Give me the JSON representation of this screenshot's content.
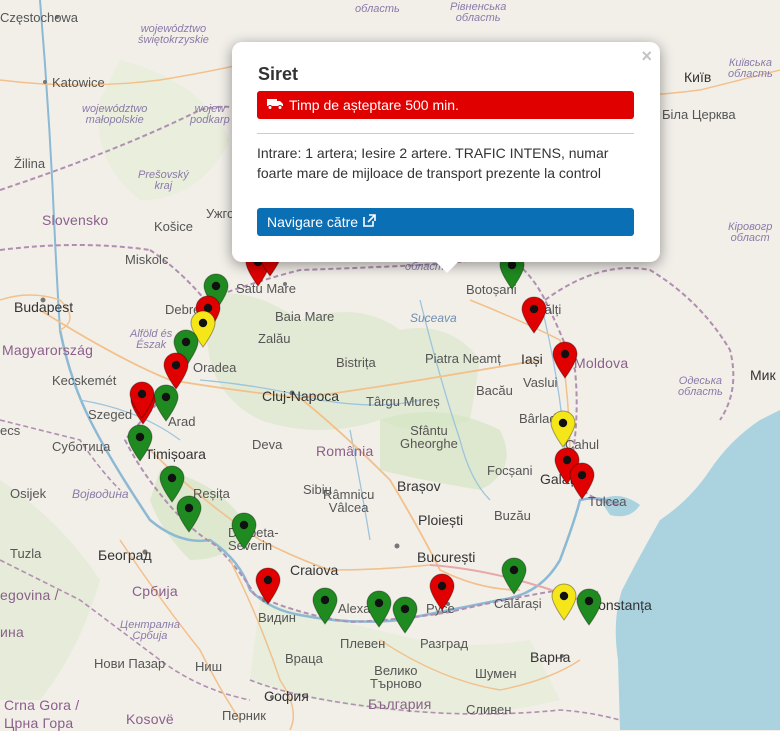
{
  "map": {
    "labels": {
      "czestochowa": "Częstochowa",
      "katowice": "Katowice",
      "woj_sw1": "województwo",
      "woj_sw2": "świętokrzyskie",
      "woj_ma1": "województwo",
      "woj_ma2": "małopolskie",
      "woj_pk1": "wojew",
      "woj_pk2": "podkarp",
      "zilina": "Žilina",
      "presov1": "Prešovský",
      "presov2": "kraj",
      "slovensko": "Slovensko",
      "kosice": "Košice",
      "uzh": "Ужго",
      "miskolc": "Miskolc",
      "budapest": "Budapest",
      "debre": "Debre",
      "alfold1": "Alföld és",
      "alfold2": "Észak",
      "magyar": "Magyarország",
      "kecskemet": "Kecskemét",
      "szeged": "Szeged",
      "szabotica": "Суботица",
      "ecs": "ecs",
      "osijek": "Osijek",
      "vojvodina": "Војводина",
      "tuzla": "Tuzla",
      "beograd": "Београд",
      "srbija": "Србија",
      "centralna1": "Централна",
      "centralna2": "Србија",
      "egovina": "egovina /",
      "ina": "ина",
      "nis": "Ниш",
      "novi_pazar": "Нови Пазар",
      "crna_gora1": "Crna Gora /",
      "crna_gora2": "Црна Гора",
      "kosove": "Kosovë",
      "satu_mare": "Satu Mare",
      "baia_mare": "Baia Mare",
      "zalau": "Zalău",
      "oradea": "Oradea",
      "arad": "Arad",
      "timisoara": "Timișoara",
      "resita": "Reșița",
      "drobeta1": "Drobeta-",
      "drobeta2": "Severin",
      "deva": "Deva",
      "cluj": "Cluj-Napoca",
      "bistrita": "Bistrița",
      "targu": "Târgu Mureș",
      "romania": "România",
      "sibiu": "Sibiu",
      "sfantu1": "Sfântu",
      "sfantu2": "Gheorghe",
      "brasov": "Brașov",
      "ramnicu1": "Râmnicu",
      "ramnicu2": "Vâlcea",
      "ploiesti": "Ploiești",
      "craiova": "Craiova",
      "bucuresti": "București",
      "calarasi": "Călărași",
      "buzau": "Buzău",
      "focsani": "Focșani",
      "bacau": "Bacău",
      "piatra": "Piatra Neamț",
      "suceava": "Suceava",
      "botosani": "Botoșani",
      "iasi": "Iași",
      "vaslui": "Vaslui",
      "barlad": "Bârlad",
      "balti": "Bălți",
      "moldova": "Moldova",
      "odesa1": "Одеська",
      "odesa2": "область",
      "galati": "Galați",
      "tulcea": "Tulcea",
      "cahul": "Cahul",
      "constanta": "Constanța",
      "mik": "Мик",
      "kirov1": "Кіровогр",
      "kirov2": "област",
      "kyiv": "Київ",
      "kyiv_obl1": "Київська",
      "kyiv_obl2": "область",
      "bila": "Біла Церква",
      "rivne1": "Рівненська",
      "rivne2": "область",
      "oblast_top": "область",
      "oblast_mid": "област",
      "vidin": "Видин",
      "alexa": "Alexa",
      "pleven": "Плевен",
      "ruse": "Русе",
      "razgrad": "Разград",
      "vratsa": "Враца",
      "veliko1": "Велико",
      "veliko2": "Търново",
      "shumen": "Шумен",
      "varna": "Варна",
      "sofia": "София",
      "bulgaria": "България",
      "pernik": "Перник",
      "sliven": "Сливен"
    },
    "colors": {
      "red": "#e00000",
      "green": "#1f8a1f",
      "yellow": "#f5e61a",
      "land": "#f2efe9",
      "sea": "#aad3df"
    },
    "markers": [
      {
        "status": "red"
      },
      {
        "status": "red"
      },
      {
        "status": "green"
      },
      {
        "status": "red"
      },
      {
        "status": "yellow"
      },
      {
        "status": "green"
      },
      {
        "status": "red"
      },
      {
        "status": "green"
      },
      {
        "status": "red"
      },
      {
        "status": "red"
      },
      {
        "status": "green"
      },
      {
        "status": "green"
      },
      {
        "status": "green"
      },
      {
        "status": "green"
      },
      {
        "status": "red"
      },
      {
        "status": "green"
      },
      {
        "status": "green"
      },
      {
        "status": "green"
      },
      {
        "status": "red"
      },
      {
        "status": "green"
      },
      {
        "status": "yellow"
      },
      {
        "status": "green"
      },
      {
        "status": "green"
      },
      {
        "status": "red"
      },
      {
        "status": "red"
      },
      {
        "status": "yellow"
      },
      {
        "status": "red"
      },
      {
        "status": "red"
      }
    ]
  },
  "popup": {
    "title": "Siret",
    "wait_label": "Timp de așteptare 500 min.",
    "description": "Intrare: 1 artera; Iesire 2 artere. TRAFIC INTENS, numar foarte mare de mijloace de transport prezente la control",
    "navigate_label": "Navigare către",
    "close_label": "×",
    "wait_color": "#e00000",
    "navigate_color": "#0a6fb4",
    "truck_icon": "truck-icon",
    "external_icon": "external-link-icon"
  }
}
